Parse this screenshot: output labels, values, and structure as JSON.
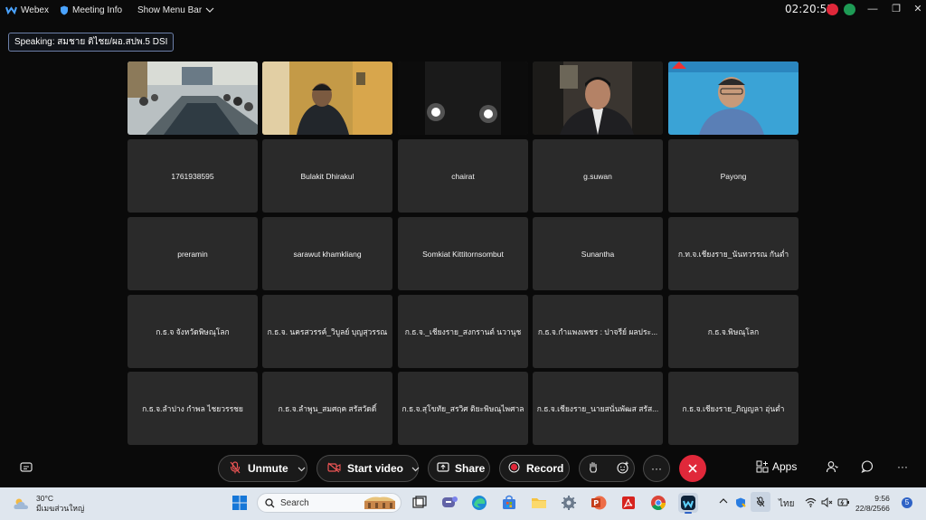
{
  "topbar": {
    "app_name": "Webex",
    "meeting_info": "Meeting Info",
    "menu_toggle": "Show Menu Bar",
    "clock": "02:20:55"
  },
  "speaking": "Speaking: สมชาย ติไชย/ผอ.สปพ.5 DSI",
  "participants_row1": [
    "",
    "",
    "",
    "",
    ""
  ],
  "participants": [
    "1761938595",
    "Bulakit Dhirakul",
    "chairat",
    "g.suwan",
    "Payong",
    "preramin",
    "sarawut khamkliang",
    "Somkiat Kittitornsombut",
    "Sunantha",
    "ก.ท.จ.เชียงราย_นันทวรรณ กันต่ำ",
    "ก.ธ.จ จังหวัดพิษณุโลก",
    "ก.ธ.จ. นครสวรรค์_วิบูลย์ บุญสุวรรณ",
    "ก.ธ.จ._เชียงราย_สงกรานต์ นวานุช",
    "ก.ธ.จ.กำแพงเพชร : ปาจรีย์ ผลประ...",
    "ก.ธ.จ.พิษณุโลก",
    "ก.ธ.จ.ลำปาง กำพล ไชยวรรชย",
    "ก.ธ.จ.ลำพูน_สมศฤค สรัสวัดดิ์",
    "ก.ธ.จ.สุโขทัย_สรวิศ ติยะพิษณุไพศาล",
    "ก.ธ.จ.เชียงราย_นายสนั่นพัฒส สรัส...",
    "ก.ธ.จ.เชียงราย_ภิญญลา อุ่นต่ำ"
  ],
  "controls": {
    "unmute": "Unmute",
    "start_video": "Start video",
    "share": "Share",
    "record": "Record",
    "more": "···",
    "apps": "Apps",
    "overflow": "···"
  },
  "taskbar": {
    "temperature": "30°C",
    "weather_desc": "มีเมฆส่วนใหญ่",
    "search_placeholder": "Search",
    "language": "ไทย",
    "time": "9:56",
    "date": "22/8/2566",
    "notifications": "5"
  },
  "colors": {
    "leave": "#e0283a",
    "record": "#e0283a",
    "tile": "#2a2a2a",
    "taskbar": "#dfe6ee"
  }
}
